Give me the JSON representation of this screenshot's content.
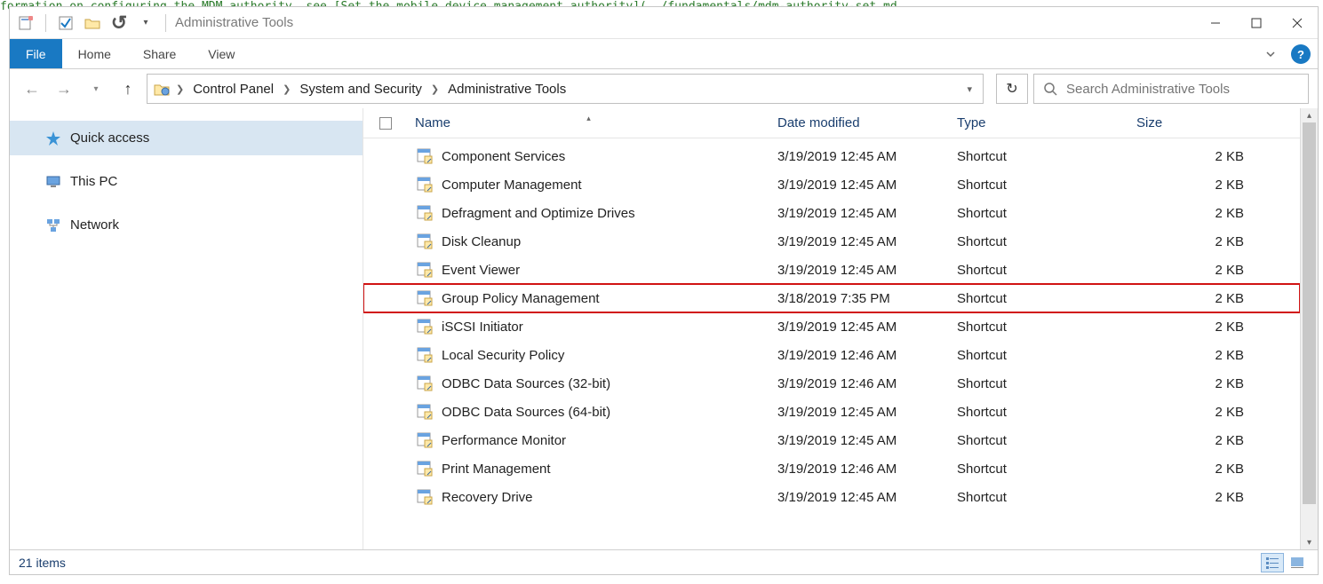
{
  "window": {
    "title": "Administrative Tools"
  },
  "ribbon": {
    "file": "File",
    "home": "Home",
    "share": "Share",
    "view": "View"
  },
  "breadcrumb": {
    "parts": [
      "Control Panel",
      "System and Security",
      "Administrative Tools"
    ]
  },
  "search": {
    "placeholder": "Search Administrative Tools"
  },
  "sidebar": {
    "items": [
      {
        "label": "Quick access",
        "selected": true,
        "icon": "star"
      },
      {
        "label": "This PC",
        "selected": false,
        "icon": "pc"
      },
      {
        "label": "Network",
        "selected": false,
        "icon": "network"
      }
    ]
  },
  "columns": {
    "name": "Name",
    "date": "Date modified",
    "type": "Type",
    "size": "Size"
  },
  "files": [
    {
      "name": "Component Services",
      "date": "3/19/2019 12:45 AM",
      "type": "Shortcut",
      "size": "2 KB",
      "hl": false
    },
    {
      "name": "Computer Management",
      "date": "3/19/2019 12:45 AM",
      "type": "Shortcut",
      "size": "2 KB",
      "hl": false
    },
    {
      "name": "Defragment and Optimize Drives",
      "date": "3/19/2019 12:45 AM",
      "type": "Shortcut",
      "size": "2 KB",
      "hl": false
    },
    {
      "name": "Disk Cleanup",
      "date": "3/19/2019 12:45 AM",
      "type": "Shortcut",
      "size": "2 KB",
      "hl": false
    },
    {
      "name": "Event Viewer",
      "date": "3/19/2019 12:45 AM",
      "type": "Shortcut",
      "size": "2 KB",
      "hl": false
    },
    {
      "name": "Group Policy Management",
      "date": "3/18/2019 7:35 PM",
      "type": "Shortcut",
      "size": "2 KB",
      "hl": true
    },
    {
      "name": "iSCSI Initiator",
      "date": "3/19/2019 12:45 AM",
      "type": "Shortcut",
      "size": "2 KB",
      "hl": false
    },
    {
      "name": "Local Security Policy",
      "date": "3/19/2019 12:46 AM",
      "type": "Shortcut",
      "size": "2 KB",
      "hl": false
    },
    {
      "name": "ODBC Data Sources (32-bit)",
      "date": "3/19/2019 12:46 AM",
      "type": "Shortcut",
      "size": "2 KB",
      "hl": false
    },
    {
      "name": "ODBC Data Sources (64-bit)",
      "date": "3/19/2019 12:45 AM",
      "type": "Shortcut",
      "size": "2 KB",
      "hl": false
    },
    {
      "name": "Performance Monitor",
      "date": "3/19/2019 12:45 AM",
      "type": "Shortcut",
      "size": "2 KB",
      "hl": false
    },
    {
      "name": "Print Management",
      "date": "3/19/2019 12:46 AM",
      "type": "Shortcut",
      "size": "2 KB",
      "hl": false
    },
    {
      "name": "Recovery Drive",
      "date": "3/19/2019 12:45 AM",
      "type": "Shortcut",
      "size": "2 KB",
      "hl": false
    }
  ],
  "status": {
    "count_label": "21 items"
  }
}
